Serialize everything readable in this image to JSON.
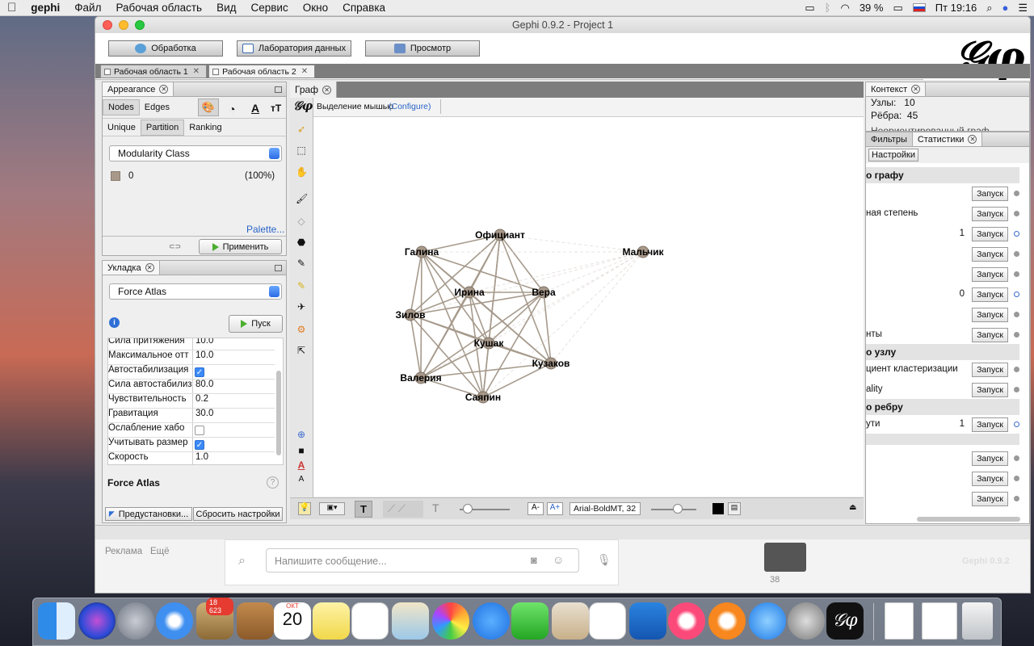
{
  "menubar": {
    "app": "gephi",
    "items": [
      "Файл",
      "Рабочая область",
      "Вид",
      "Сервис",
      "Окно",
      "Справка"
    ],
    "battery": "39 %",
    "clock": "Пт 19:16"
  },
  "window": {
    "title": "Gephi 0.9.2 - Project 1",
    "toolbar": {
      "overview": "Обработка",
      "data_lab": "Лаборатория данных",
      "preview": "Просмотр"
    },
    "workspace_tabs": [
      "Рабочая область 1",
      "Рабочая область 2"
    ]
  },
  "appearance": {
    "title": "Appearance",
    "tabs": [
      "Nodes",
      "Edges"
    ],
    "modes": [
      "Unique",
      "Partition",
      "Ranking"
    ],
    "attribute": "Modularity Class",
    "partition_value": "0",
    "partition_pct": "(100%)",
    "partition_color": "#a8998a",
    "palette_link": "Palette...",
    "apply_button": "Применить"
  },
  "layout": {
    "title": "Укладка",
    "algorithm": "Force Atlas",
    "run_button": "Пуск",
    "properties": [
      {
        "key": "Сила притяжения",
        "value": "10.0"
      },
      {
        "key": "Максимальное отт",
        "value": "10.0"
      },
      {
        "key": "Автостабилизация",
        "value": "✓"
      },
      {
        "key": "Сила автостабилиз",
        "value": "80.0"
      },
      {
        "key": "Чувствительность",
        "value": "0.2"
      },
      {
        "key": "Гравитация",
        "value": "30.0"
      },
      {
        "key": "Ослабление хабо",
        "value": ""
      },
      {
        "key": "Учитывать размер",
        "value": "✓"
      },
      {
        "key": "Скорость",
        "value": "1.0"
      }
    ],
    "description_title": "Force Atlas",
    "presets_button": "Предустановки...",
    "reset_button": "Сбросить настройки"
  },
  "graph": {
    "tab": "Граф",
    "mode_label": "Выделение мышью",
    "configure_link": "(Configure)",
    "font_label": "Arial-BoldMT, 32",
    "nodes": [
      "Официант",
      "Галина",
      "Мальчик",
      "Ирина",
      "Вера",
      "Зилов",
      "Кушак",
      "Кузаков",
      "Валерия",
      "Саяпин"
    ]
  },
  "context": {
    "title": "Контекст",
    "nodes_label": "Узлы:",
    "nodes_value": "10",
    "edges_label": "Рёбра:",
    "edges_value": "45",
    "graph_type": "Неориентированный граф"
  },
  "statistics": {
    "tabs": [
      "Фильтры",
      "Статистики"
    ],
    "settings_button": "Настройки",
    "run_label": "Запуск",
    "sections": {
      "graph": "о графу",
      "node": "о узлу",
      "edge": "о ребру"
    },
    "rows": [
      "",
      "ная степень",
      "",
      "",
      "",
      "",
      "",
      "нты",
      "циент кластеризации",
      "ality",
      "ути",
      "",
      "",
      ""
    ],
    "numbers": {
      "avg_degree": "1",
      "components": "0",
      "path": "1"
    }
  },
  "chat": {
    "ads": "Реклама",
    "more": "Ещё",
    "placeholder": "Напишите сообщение...",
    "count": "38",
    "version_badge": "Gephi 0.9.2"
  },
  "dock": {
    "mail_badge": "18 623",
    "calendar_month": "ОКТ",
    "calendar_day": "20"
  }
}
